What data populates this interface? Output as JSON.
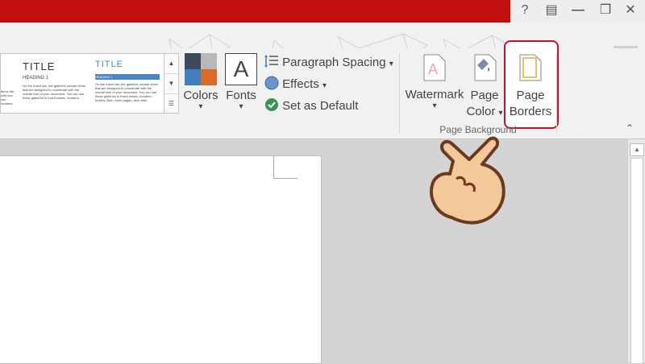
{
  "window": {
    "help_label": "?",
    "ribbon_display_label": "▤",
    "restore_label": "❒",
    "close_label": "✕",
    "account_menu_arrow": "▾"
  },
  "style_gallery": {
    "thumb1": {
      "title": "TITLE",
      "heading": "HEADING 1",
      "body": "On the Insert tab, the galleries include items that are designed to coordinate with the overall look of your document. You can use these galleries to insert tables, headers,"
    },
    "thumb2": {
      "title": "TITLE",
      "heading": "HEADING 1",
      "body": "On the Insert tab, the galleries include items that are designed to coordinate with the overall look of your document. You can use these galleries to insert tables, headers, footers, lists, cover pages, and other"
    },
    "clipped_text": "items the with you can headers,",
    "scroll_up": "▲",
    "scroll_down": "▼",
    "more": "☰"
  },
  "ribbon": {
    "colors_label": "Colors",
    "fonts_label": "Fonts",
    "fonts_glyph": "A",
    "paragraph_spacing_label": "Paragraph Spacing",
    "effects_label": "Effects",
    "set_default_label": "Set as Default",
    "watermark_label": "Watermark",
    "page_color_label_1": "Page",
    "page_color_label_2": "Color",
    "page_borders_label_1": "Page",
    "page_borders_label_2": "Borders",
    "group_label": "Page Background",
    "dropdown_arrow": "▾",
    "collapse_arrow": "⌃"
  },
  "colors": {
    "title_bar_red": "#c21010",
    "highlight_border": "#c8102e",
    "theme_swatch_1": "#3a4a5c",
    "theme_swatch_2": "#b8b8b8",
    "theme_swatch_3": "#3f7fc0",
    "theme_swatch_4": "#d86b2a",
    "heading_blue": "#4a86c5",
    "hand_skin": "#f5c89a"
  },
  "scrollbar": {
    "up_arrow": "▲"
  }
}
